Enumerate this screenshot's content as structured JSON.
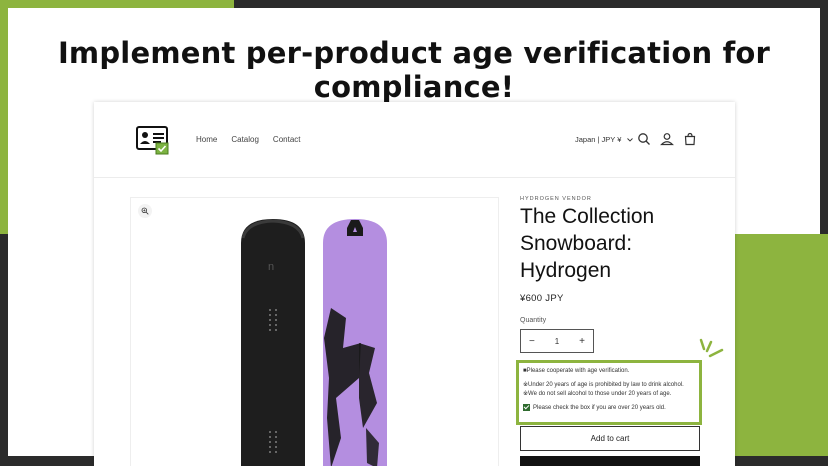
{
  "headline": "Implement per-product age verification for compliance!",
  "nav": {
    "home": "Home",
    "catalog": "Catalog",
    "contact": "Contact"
  },
  "header": {
    "locale": "Japan | JPY ¥"
  },
  "product": {
    "vendor": "HYDROGEN VENDOR",
    "title": "The Collection Snowboard: Hydrogen",
    "price": "¥600 JPY",
    "quantity_label": "Quantity",
    "quantity_value": "1",
    "minus": "−",
    "plus": "+",
    "add_to_cart": "Add to cart"
  },
  "age_verification": {
    "line1": "■Please cooperate with age verification.",
    "line2": "※Under 20 years of age is prohibited by law to drink alcohol.",
    "line3": "※We do not sell alcohol to those under 20 years of age.",
    "checkbox_label": "Please check the box if you are over 20 years old."
  },
  "colors": {
    "brand_green": "#8db43f",
    "dark": "#2b2b2b",
    "board_purple": "#b48ee0"
  }
}
